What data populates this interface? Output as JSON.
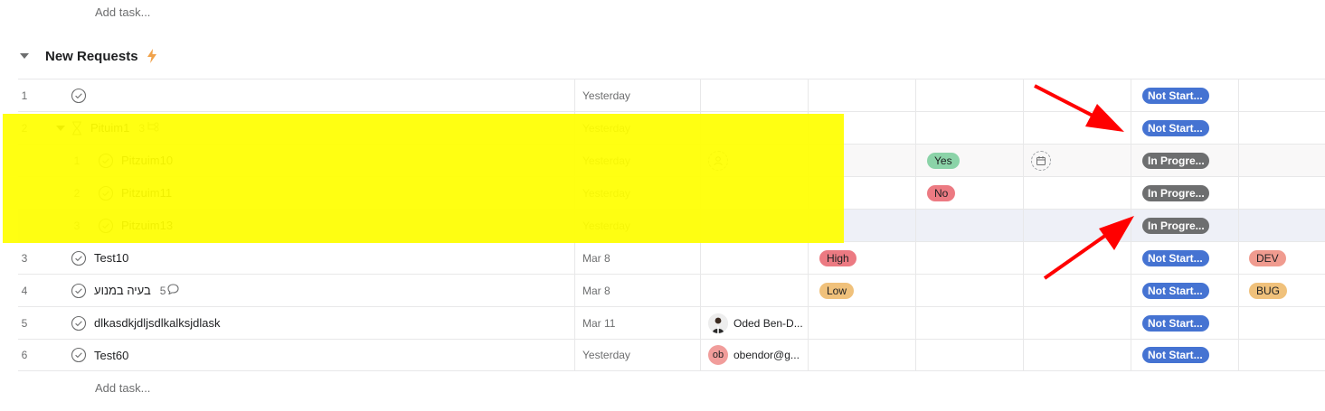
{
  "top_add_task": "Add task...",
  "section": {
    "title": "New Requests"
  },
  "rows": [
    {
      "num": "1",
      "name": "",
      "date": "Yesterday",
      "status": "Not Start..."
    },
    {
      "num": "2",
      "name": "Pituim1",
      "subtasks": "3",
      "date": "Yesterday",
      "status": "Not Start..."
    },
    {
      "num": "1",
      "name": "Pitzuim10",
      "date": "Yesterday",
      "yesno": "Yes",
      "status": "In Progre..."
    },
    {
      "num": "2",
      "name": "Pitzuim11",
      "date": "Yesterday",
      "yesno": "No",
      "status": "In Progre..."
    },
    {
      "num": "3",
      "name": "Pitzuim13",
      "date": "Yesterday",
      "status": "In Progre..."
    },
    {
      "num": "3",
      "name": "Test10",
      "date": "Mar 8",
      "priority": "High",
      "status": "Not Start...",
      "tag": "DEV"
    },
    {
      "num": "4",
      "name": "בעיה במנוע",
      "comments": "5",
      "date": "Mar 8",
      "priority": "Low",
      "status": "Not Start...",
      "tag": "BUG"
    },
    {
      "num": "5",
      "name": "dlkasdkjdljsdlkalksjdlask",
      "date": "Mar 11",
      "assignee": "Oded Ben-D...",
      "status": "Not Start..."
    },
    {
      "num": "6",
      "name": "Test60",
      "date": "Yesterday",
      "assignee_initials": "ob",
      "assignee": "obendor@g...",
      "status": "Not Start..."
    }
  ],
  "bottom_add_task": "Add task...",
  "colors": {
    "status_blue": "#4573d2",
    "status_gray": "#6d6e6f",
    "highlight": "#ffff00",
    "arrow": "#ff0000"
  }
}
